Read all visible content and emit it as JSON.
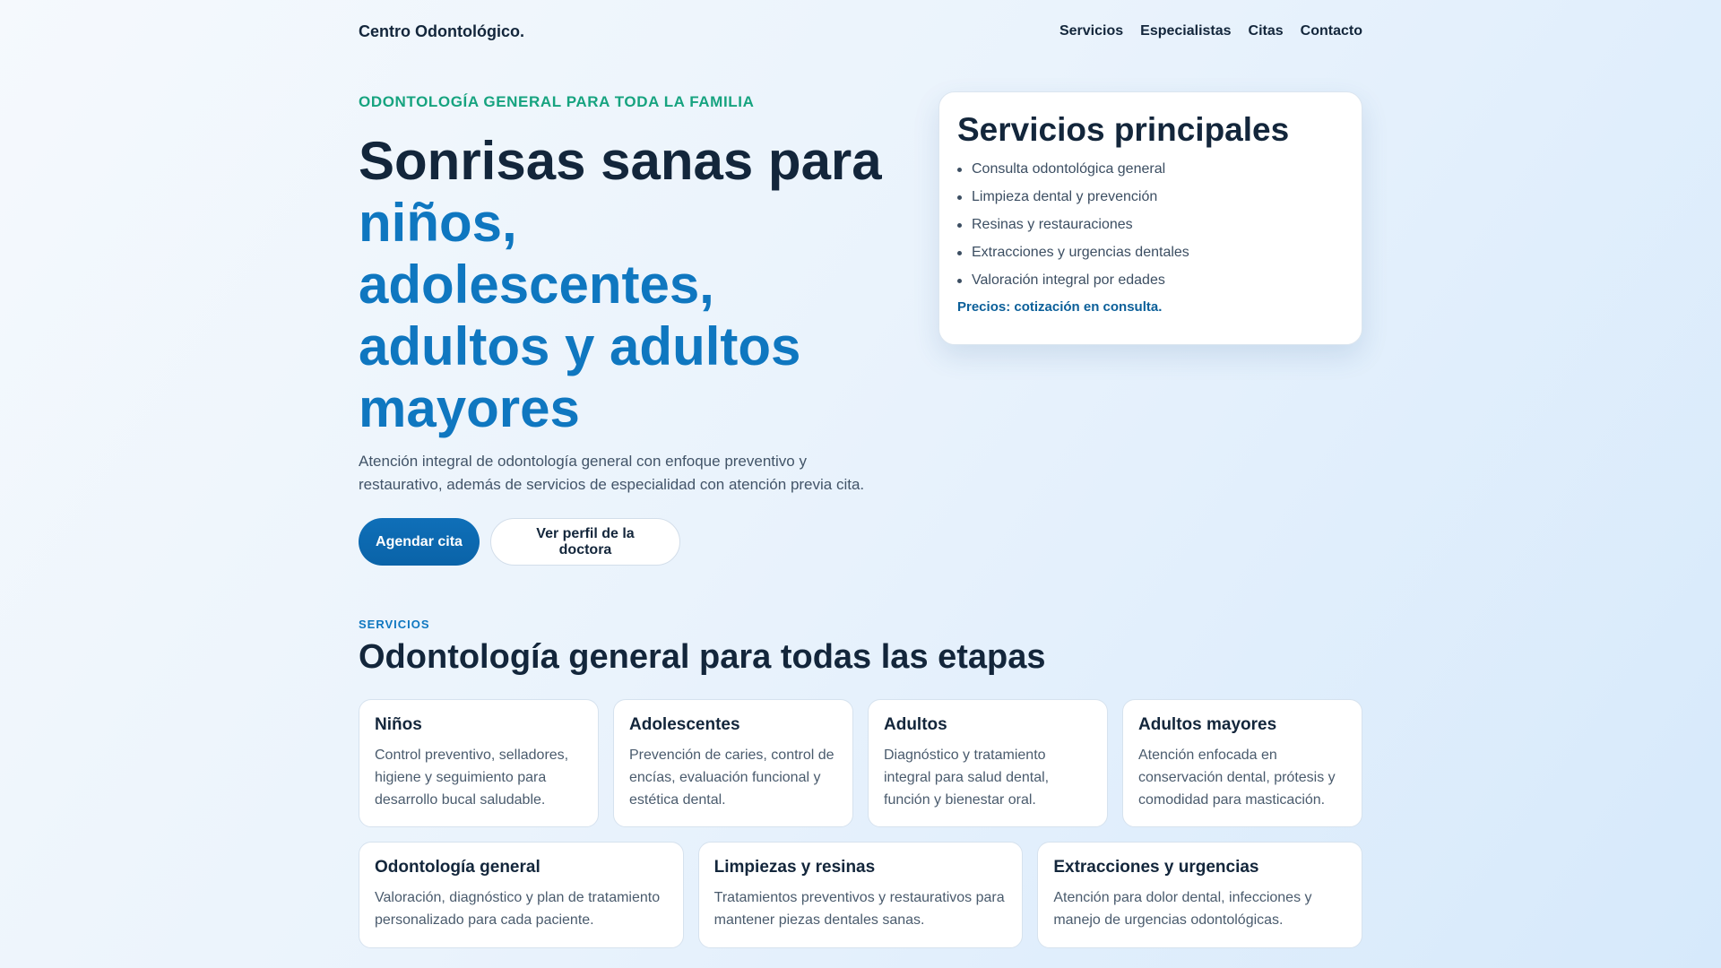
{
  "header": {
    "brand": "Centro Odontológico.",
    "nav": [
      "Servicios",
      "Especialistas",
      "Citas",
      "Contacto"
    ]
  },
  "hero": {
    "eyebrow": "ODONTOLOGÍA GENERAL PARA TODA LA FAMILIA",
    "title_plain": "Sonrisas sanas para",
    "title_highlight": [
      "niños, adolescentes,",
      "adultos y adultos",
      "mayores"
    ],
    "description": "Atención integral de odontología general con enfoque preventivo y restaurativo, además de servicios de especialidad con atención previa cita.",
    "primary_button": "Agendar cita",
    "secondary_button": "Ver perfil de la doctora"
  },
  "card": {
    "title": "Servicios principales",
    "items": [
      "Consulta odontológica general",
      "Limpieza dental y prevención",
      "Resinas y restauraciones",
      "Extracciones y urgencias dentales",
      "Valoración integral por edades"
    ],
    "price_note": "Precios: cotización en consulta."
  },
  "services": {
    "eyebrow": "SERVICIOS",
    "title": "Odontología general para todas las etapas",
    "row1": [
      {
        "title": "Niños",
        "text": "Control preventivo, selladores, higiene y seguimiento para desarrollo bucal saludable."
      },
      {
        "title": "Adolescentes",
        "text": "Prevención de caries, control de encías, evaluación funcional y estética dental."
      },
      {
        "title": "Adultos",
        "text": "Diagnóstico y tratamiento integral para salud dental, función y bienestar oral."
      },
      {
        "title": "Adultos mayores",
        "text": "Atención enfocada en conservación dental, prótesis y comodidad para masticación."
      }
    ],
    "row2": [
      {
        "title": "Odontología general",
        "text": "Valoración, diagnóstico y plan de tratamiento personalizado para cada paciente."
      },
      {
        "title": "Limpiezas y resinas",
        "text": "Tratamientos preventivos y restaurativos para mantener piezas dentales sanas."
      },
      {
        "title": "Extracciones y urgencias",
        "text": "Atención para dolor dental, infecciones y manejo de urgencias odontológicas."
      }
    ]
  },
  "colors": {
    "accent_blue": "#0f77c0",
    "accent_green": "#16a37f",
    "text_dark": "#13263b"
  }
}
